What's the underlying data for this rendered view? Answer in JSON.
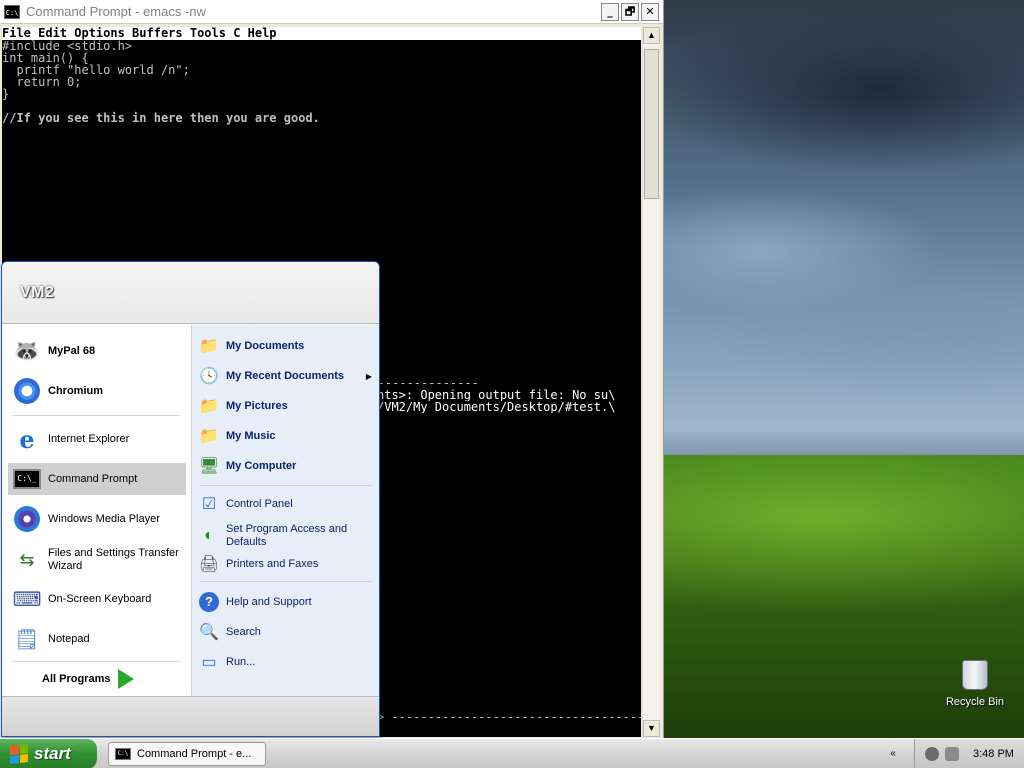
{
  "window": {
    "title": "Command Prompt - emacs -nw",
    "minimize": "_",
    "maximize": "🗗",
    "close": "✕"
  },
  "emacs": {
    "menubar": "File Edit Options Buffers Tools C Help",
    "lines": [
      {
        "cls": "k-prep",
        "text": "#include <stdio.h>"
      },
      {
        "cls": "k-kw",
        "text": "int main() {"
      },
      {
        "cls": "k-plain",
        "text": "  printf \"hello world /n\";"
      },
      {
        "cls": "k-kw",
        "text": "  return 0;"
      },
      {
        "cls": "k-plain",
        "text": "}"
      },
      {
        "cls": "k-plain",
        "text": ""
      },
      {
        "cls": "k-cm",
        "text": "//If you see this in here then you are good."
      }
    ],
    "modeline_top": "prev) ------------------------------------------------------------",
    "echo1": "nts>: Opening output file: No su\\",
    "echo2": "/VM2/My Documents/Desktop/#test.\\",
    "modeline_bottom": "> -----------------------------------------------------------------"
  },
  "startmenu": {
    "user": "VM2",
    "pinned": [
      {
        "name": "mypal-icon",
        "label": "MyPal 68",
        "glyph": "🦝"
      },
      {
        "name": "chromium-icon",
        "label": "Chromium",
        "glyph": "◉"
      }
    ],
    "recent": [
      {
        "name": "internet-explorer-icon",
        "label": "Internet Explorer"
      },
      {
        "name": "command-prompt-icon",
        "label": "Command Prompt"
      },
      {
        "name": "windows-media-player-icon",
        "label": "Windows Media Player"
      },
      {
        "name": "files-settings-transfer-icon",
        "label": "Files and Settings Transfer Wizard"
      },
      {
        "name": "on-screen-keyboard-icon",
        "label": "On-Screen Keyboard"
      },
      {
        "name": "notepad-icon",
        "label": "Notepad"
      }
    ],
    "all_programs": "All Programs",
    "right": {
      "my_documents": "My Documents",
      "my_recent_documents": "My Recent Documents",
      "my_pictures": "My Pictures",
      "my_music": "My Music",
      "my_computer": "My Computer",
      "control_panel": "Control Panel",
      "set_program_access": "Set Program Access and Defaults",
      "printers_faxes": "Printers and Faxes",
      "help_support": "Help and Support",
      "search": "Search",
      "run": "Run..."
    }
  },
  "desktop": {
    "recycle_bin": "Recycle Bin"
  },
  "taskbar": {
    "start": "start",
    "task_cmd": "Command Prompt - e...",
    "clock": "3:48 PM",
    "tray_arrow": "«"
  }
}
